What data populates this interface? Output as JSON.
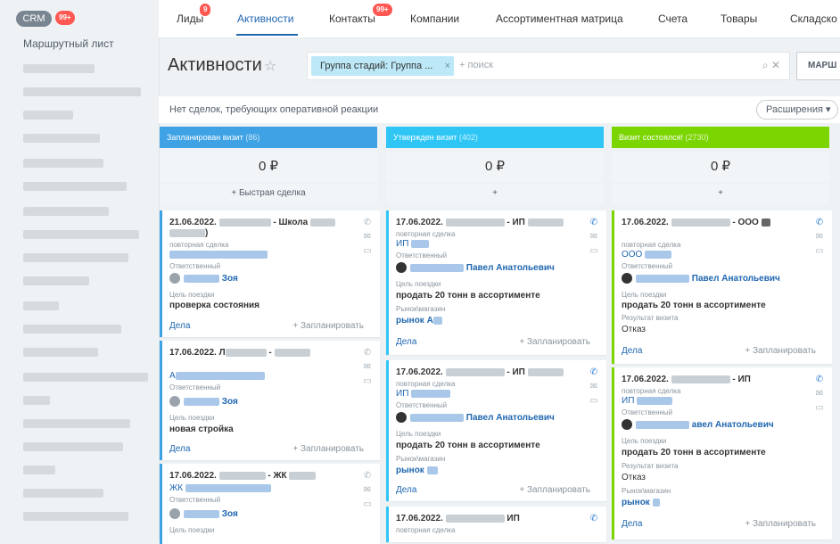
{
  "sidebar": {
    "crm_label": "CRM",
    "crm_badge": "99+",
    "section_title": "Маршрутный лист"
  },
  "tabs": [
    {
      "label": "Лиды",
      "badge": "9"
    },
    {
      "label": "Активности"
    },
    {
      "label": "Контакты",
      "badge": "99+"
    },
    {
      "label": "Компании"
    },
    {
      "label": "Ассортиментная матрица"
    },
    {
      "label": "Счета"
    },
    {
      "label": "Товары"
    },
    {
      "label": "Складско"
    }
  ],
  "header": {
    "title": "Активности",
    "filter_chip": "Группа стадий: Группа ...",
    "search_placeholder": "+ поиск",
    "route_button": "МАРШ",
    "notice": "Нет сделок, требующих оперативной реакции",
    "extensions_button": "Расширения"
  },
  "columns": [
    {
      "name": "Запланирован визит",
      "count": "(86)",
      "sum": "0 ₽",
      "add": "+ Быстрая сделка",
      "color": "#3ea2e5"
    },
    {
      "name": "Утвержден визит",
      "count": "(402)",
      "sum": "0 ₽",
      "add": "+",
      "color": "#2fc6f6"
    },
    {
      "name": "Визит состоялся!",
      "count": "(2730)",
      "sum": "0 ₽",
      "add": "+",
      "color": "#7bd500"
    }
  ],
  "labels": {
    "repeat": "повторная сделка",
    "responsible": "Ответственный",
    "trip_goal": "Цель поездки",
    "market": "Рынок\\магазин",
    "visit_result": "Результат визита",
    "deals": "Дела",
    "plan": "+ Запланировать"
  },
  "cards": {
    "c1": {
      "title_date": "21.06.2022.",
      "title_mid": "- Школа",
      "title_tail": ")",
      "owner": "Зоя",
      "goal": "проверка состояния"
    },
    "c2": {
      "title_date": "17.06.2022. Л",
      "title_mid": "-",
      "link": "А",
      "owner": "Зоя",
      "goal": "новая стройка"
    },
    "c3": {
      "title_date": "17.06.2022.",
      "title_mid": "- ЖК",
      "link": "ЖК",
      "owner": "Зоя"
    },
    "c4": {
      "title_date": "17.06.2022.",
      "title_mid": "- ИП",
      "link": "ИП",
      "owner": "Павел Анатольевич",
      "goal": "продать 20 тонн в ассортименте",
      "market": "рынок А"
    },
    "c5": {
      "title_date": "17.06.2022.",
      "title_mid": "- ИП",
      "link": "ИП",
      "owner": "Павел Анатольевич",
      "goal": "продать 20 тонн в ассортименте",
      "market": "рынок"
    },
    "c6": {
      "title_date": "17.06.2022.",
      "title_mid": "ИП"
    },
    "c7": {
      "title_date": "17.06.2022.",
      "title_mid": "- ООО",
      "link": "ООО",
      "owner": "Павел Анатольевич",
      "goal": "продать 20 тонн в ассортименте",
      "result": "Отказ"
    },
    "c8": {
      "title_date": "17.06.2022.",
      "title_mid": "- ИП",
      "link": "ИП",
      "owner": "авел Анатольевич",
      "goal": "продать 20 тонн в ассортименте",
      "result": "Отказ",
      "market": "рынок"
    }
  }
}
